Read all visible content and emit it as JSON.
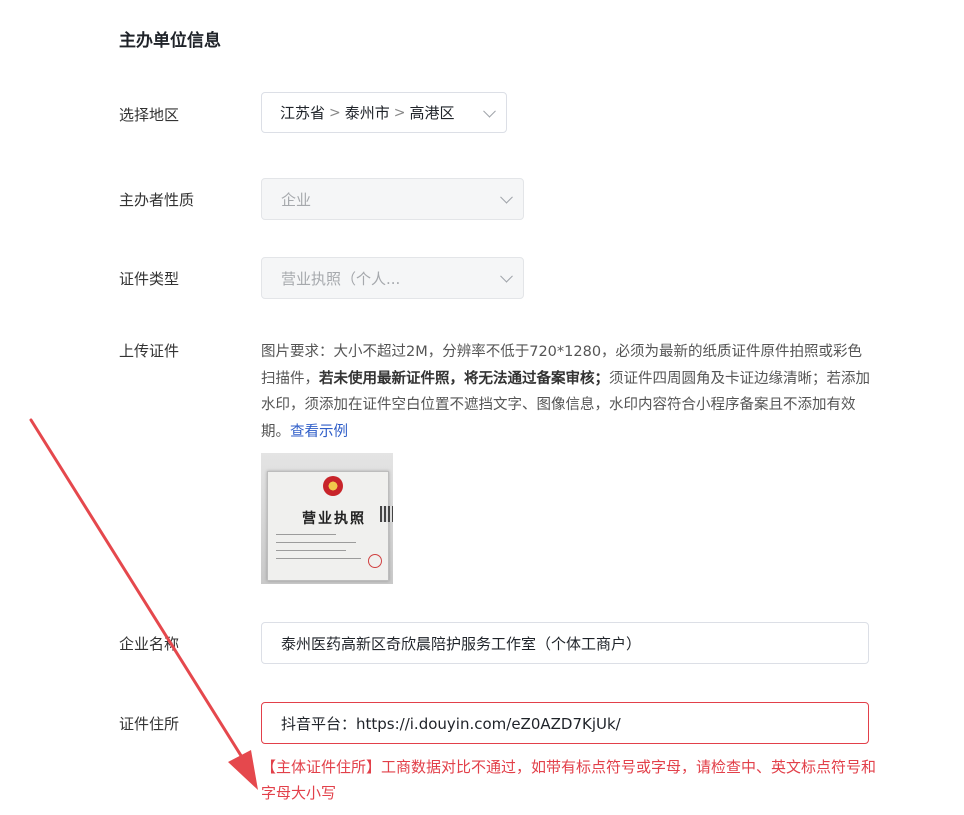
{
  "section_title": "主办单位信息",
  "region": {
    "label": "选择地区",
    "province": "江苏省",
    "city": "泰州市",
    "district": "高港区",
    "separator": ">"
  },
  "host_nature": {
    "label": "主办者性质",
    "value": "企业"
  },
  "id_type": {
    "label": "证件类型",
    "value": "营业执照（个人..."
  },
  "upload": {
    "label": "上传证件",
    "desc_part1": "图片要求：大小不超过2M，分辨率不低于720*1280，必须为最新的纸质证件原件拍照或彩色扫描件，",
    "desc_bold": "若未使用最新证件照，将无法通过备案审核；",
    "desc_part2": "须证件四周圆角及卡证边缘清晰；若添加水印，须添加在证件空白位置不遮挡文字、图像信息，水印内容符合小程序备案且不添加有效期。",
    "example_link": "查看示例",
    "license_title": "营业执照"
  },
  "company_name": {
    "label": "企业名称",
    "value": "泰州医药高新区奇欣晨陪护服务工作室（个体工商户）"
  },
  "address": {
    "label": "证件住所",
    "value": "抖音平台：https://i.douyin.com/eZ0AZD7KjUk/"
  },
  "error_message": "【主体证件住所】工商数据对比不通过，如带有标点符号或字母，请检查中、英文标点符号和字母大小写",
  "colors": {
    "error": "#e2404a",
    "link": "#2f5ec8",
    "annotation_arrow": "#e5484d"
  }
}
